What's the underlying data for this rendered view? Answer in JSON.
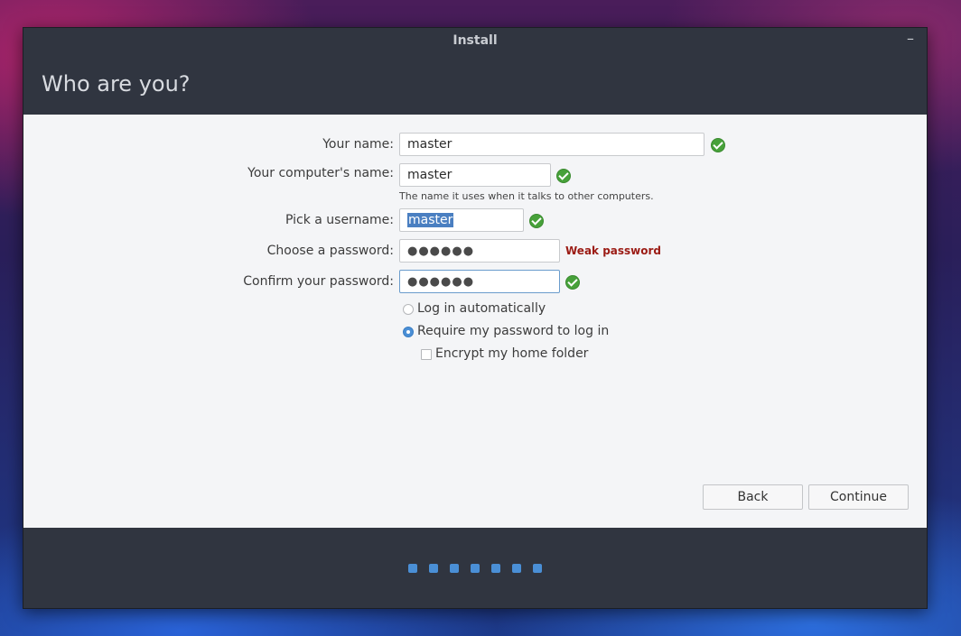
{
  "window": {
    "title": "Install",
    "minimize_glyph": "–",
    "heading": "Who are you?"
  },
  "form": {
    "name": {
      "label": "Your name:",
      "value": "master"
    },
    "computer": {
      "label": "Your computer's name:",
      "value": "master",
      "hint": "The name it uses when it talks to other computers."
    },
    "username": {
      "label": "Pick a username:",
      "value": "master"
    },
    "password": {
      "label": "Choose a password:",
      "value": "●●●●●●",
      "strength": "Weak password"
    },
    "confirm": {
      "label": "Confirm your password:",
      "value": "●●●●●●"
    },
    "options": {
      "auto_login": "Log in automatically",
      "require_password": "Require my password to log in",
      "encrypt_home": "Encrypt my home folder"
    }
  },
  "buttons": {
    "back": "Back",
    "continue": "Continue"
  },
  "progress": {
    "total_steps": 7
  },
  "colors": {
    "accent": "#4a8fd6",
    "valid": "#47a13a",
    "weak": "#9b1b14",
    "chrome": "#303540"
  }
}
